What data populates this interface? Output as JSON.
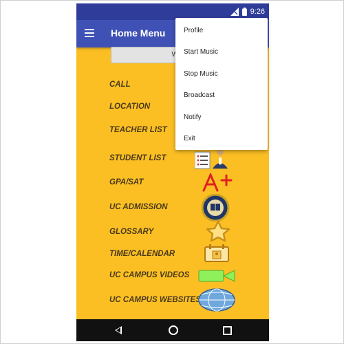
{
  "status": {
    "time": "9:26"
  },
  "appbar": {
    "title": "Home Menu"
  },
  "wifi_button": {
    "label": "WIFI"
  },
  "menu": {
    "items": [
      {
        "label": "CALL",
        "icon": "phone-icon"
      },
      {
        "label": "LOCATION",
        "icon": "map-pin-icon"
      },
      {
        "label": "TEACHER LIST",
        "icon": "teacher-icon"
      },
      {
        "label": "STUDENT LIST",
        "icon": "student-list-icon"
      },
      {
        "label": "GPA/SAT",
        "icon": "a-plus-icon"
      },
      {
        "label": "UC ADMISSION",
        "icon": "uc-seal-icon"
      },
      {
        "label": "GLOSSARY",
        "icon": "star-icon"
      },
      {
        "label": "TIME/CALENDAR",
        "icon": "calendar-icon"
      },
      {
        "label": "UC CAMPUS VIDEOS",
        "icon": "video-camera-icon"
      },
      {
        "label": "UC CAMPUS WEBSITES",
        "icon": "globe-icon"
      }
    ]
  },
  "overflow_menu": {
    "items": [
      {
        "label": "Profile"
      },
      {
        "label": "Start Music"
      },
      {
        "label": "Stop Music"
      },
      {
        "label": "Broadcast"
      },
      {
        "label": "Notify"
      },
      {
        "label": "Exit"
      }
    ]
  },
  "colors": {
    "background": "#fbbf24",
    "appbar": "#3f51b5",
    "statusbar": "#2f3c9a",
    "menu_text": "#4a3a1a"
  }
}
